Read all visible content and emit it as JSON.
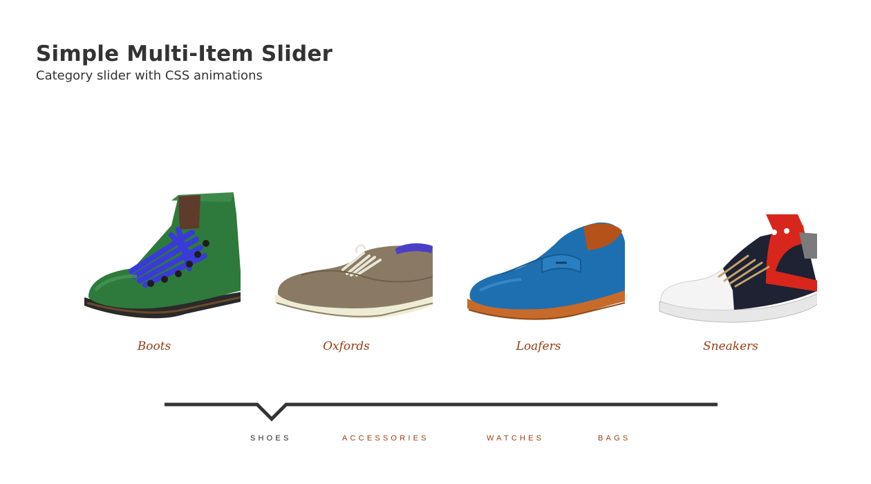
{
  "header": {
    "title": "Simple Multi-Item Slider",
    "subtitle": "Category slider with CSS animations"
  },
  "slider": {
    "items": [
      {
        "label": "Boots",
        "icon": "boot-icon"
      },
      {
        "label": "Oxfords",
        "icon": "oxford-shoe-icon"
      },
      {
        "label": "Loafers",
        "icon": "loafer-icon"
      },
      {
        "label": "Sneakers",
        "icon": "sneaker-icon"
      }
    ]
  },
  "nav": {
    "active_index": 0,
    "items": [
      {
        "label": "SHOES"
      },
      {
        "label": "ACCESSORIES"
      },
      {
        "label": "WATCHES"
      },
      {
        "label": "BAGS"
      }
    ]
  },
  "colors": {
    "text": "#333333",
    "accent": "#9a3b12",
    "active_nav": "#222222",
    "nav_line": "#333333"
  }
}
